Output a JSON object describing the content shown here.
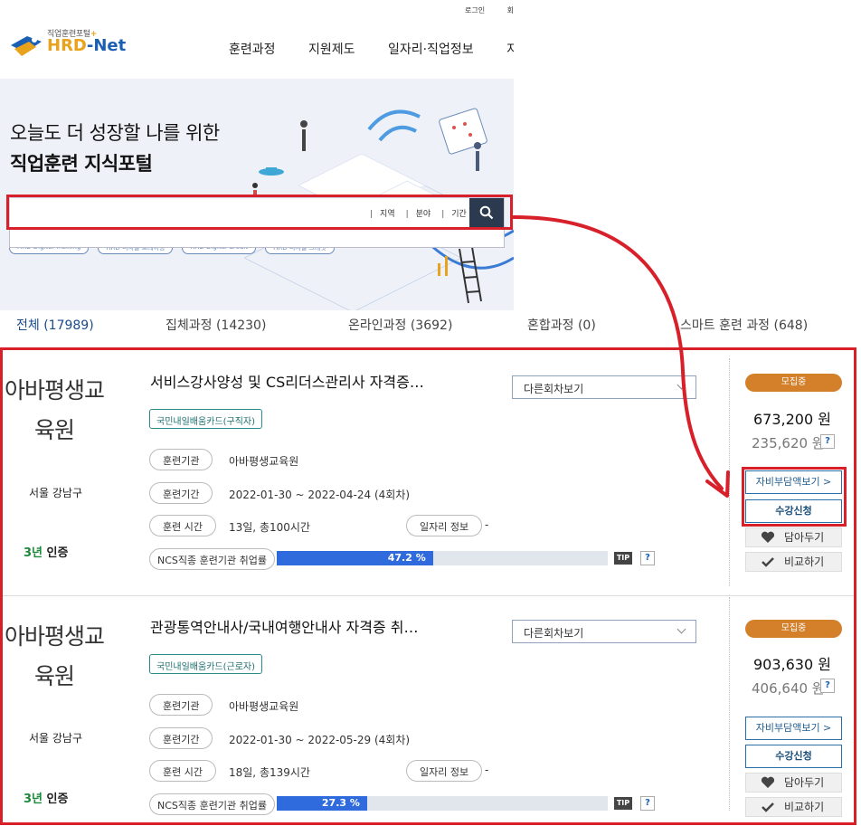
{
  "header": {
    "util_links": [
      "로그인",
      "회"
    ],
    "logo_sub": "직업훈련포털",
    "logo_plus": "+",
    "logo_main": "HRD",
    "logo_main_suffix": "-Net",
    "nav": [
      "훈련과정",
      "지원제도",
      "일자리·직업정보",
      "지식"
    ]
  },
  "hero": {
    "headline_line1": "오늘도 더 성장할 나를 위한",
    "headline_line2": "직업훈련 지식포털",
    "tags": [
      "HRD Digital Training",
      "HRD 디지털 트레이닝",
      "HRD Digital Credit",
      "HRD 디지털 크레딧"
    ]
  },
  "search": {
    "placeholder": "",
    "filters": [
      "지역",
      "분야",
      "기간"
    ],
    "button_icon": "search-icon"
  },
  "tabs": [
    "전체 (17989)",
    "집체과정 (14230)",
    "온라인과정 (3692)",
    "혼합과정 (0)",
    "스마트 훈련 과정 (648)"
  ],
  "courses": [
    {
      "institution_line1": "아바평생교",
      "institution_line2": "육원",
      "region": "서울 강남구",
      "cert_years": "3년",
      "cert_label": "인증",
      "title": "서비스강사양성 및 CS리더스관리사 자격증…",
      "session_select": "다른회차보기",
      "card_type": "국민내일배움카드(구직자)",
      "org_label": "훈련기관",
      "org_value": "아바평생교육원",
      "period_label": "훈련기간",
      "period_value": "2022-01-30 ~ 2022-04-24 (4회차)",
      "time_label": "훈련 시간",
      "time_value": "13일, 총100시간",
      "job_label": "일자리 정보",
      "job_value": "-",
      "ncs_label": "NCS직종 훈련기관 취업률",
      "rate_text": "47.2 %",
      "rate": 47.2,
      "tip": "TIP",
      "help": "?",
      "status": "모집중",
      "price": "673,200 원",
      "self_pay": "235,620 원",
      "self_pay_button": "자비부담액보기 >",
      "apply_button": "수강신청",
      "save_button": "담아두기",
      "compare_button": "비교하기"
    },
    {
      "institution_line1": "아바평생교",
      "institution_line2": "육원",
      "region": "서울 강남구",
      "cert_years": "3년",
      "cert_label": "인증",
      "title": "관광통역안내사/국내여행안내사 자격증 취…",
      "session_select": "다른회차보기",
      "card_type": "국민내일배움카드(근로자)",
      "org_label": "훈련기관",
      "org_value": "아바평생교육원",
      "period_label": "훈련기간",
      "period_value": "2022-01-30 ~ 2022-05-29 (4회차)",
      "time_label": "훈련 시간",
      "time_value": "18일, 총139시간",
      "job_label": "일자리 정보",
      "job_value": "-",
      "ncs_label": "NCS직종 훈련기관 취업률",
      "rate_text": "27.3 %",
      "rate": 27.3,
      "tip": "TIP",
      "help": "?",
      "status": "모집중",
      "price": "903,630 원",
      "self_pay": "406,640 원",
      "self_pay_button": "자비부담액보기 >",
      "apply_button": "수강신청",
      "save_button": "담아두기",
      "compare_button": "비교하기"
    }
  ],
  "annotation": {
    "color": "#d8202a"
  }
}
